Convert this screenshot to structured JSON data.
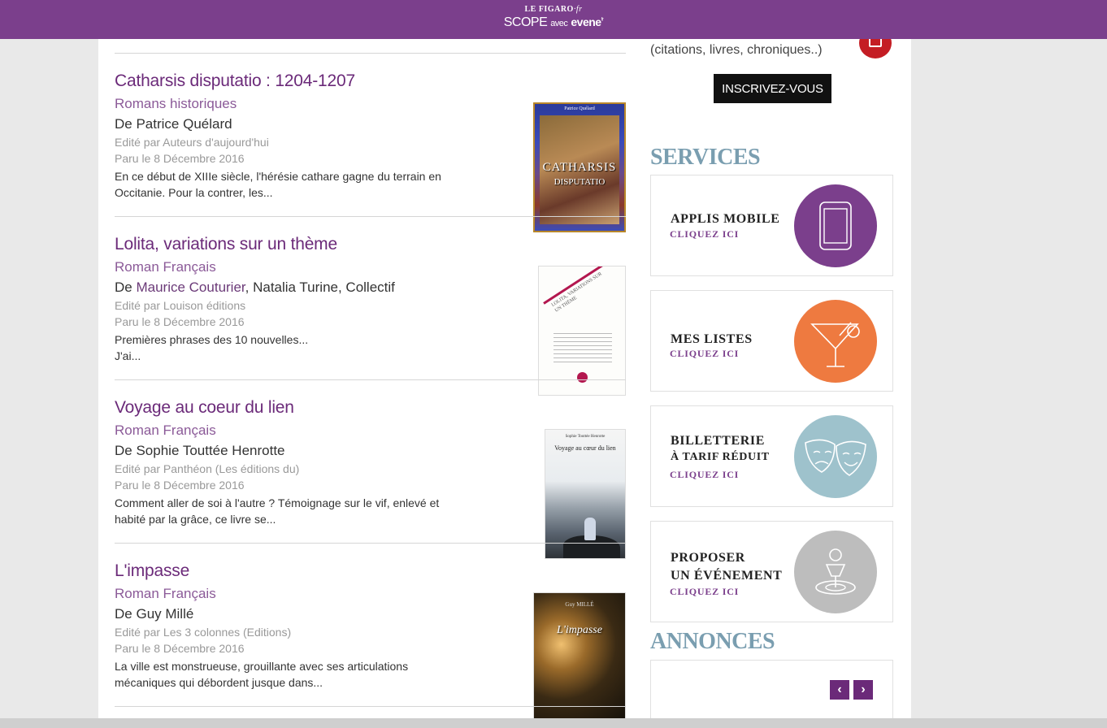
{
  "header": {
    "brand_top": "LE FIGARO",
    "brand_top_suffix": "·fr",
    "brand_scope": "SCOPE",
    "brand_avec": "avec",
    "brand_evene": "evene",
    "brand_evene_suffix": "fr"
  },
  "books": [
    {
      "title": "Catharsis disputatio : 1204-1207",
      "genre": "Romans historiques",
      "author_prefix": "De",
      "author": "Patrice Quélard",
      "editor": "Edité par Auteurs d'aujourd'hui",
      "date": "Paru le 8 Décembre 2016",
      "description": "En ce début de XIIIe siècle, l'hérésie cathare gagne du terrain en Occitanie. Pour la contrer, les...",
      "cover_header": "Patrice Quélard",
      "cover_title": "CATHARSIS",
      "cover_subtitle": "DISPUTATIO"
    },
    {
      "title": "Lolita, variations sur un thème",
      "genre": "Roman Français",
      "author_prefix": "De",
      "author_link": "Maurice Couturier",
      "author_rest": ", Natalia Turine, Collectif",
      "editor": "Edité par Louison éditions",
      "date": "Paru le 8 Décembre 2016",
      "description": "Premières phrases des 10 nouvelles...",
      "description_2": "J'ai...",
      "cover_title": "LOLITA, VARIATIONS SUR UN THÈME"
    },
    {
      "title": "Voyage au coeur du lien",
      "genre": "Roman Français",
      "author_prefix": "De",
      "author": "Sophie Touttée Henrotte",
      "editor": "Edité par Panthéon (Les éditions du)",
      "date": "Paru le 8 Décembre 2016",
      "description": "Comment aller de soi à l'autre ? Témoignage sur le vif, enlevé et habité par la grâce, ce livre se...",
      "cover_author": "Sophie Touttée Henrotte",
      "cover_title": "Voyage au cœur du lien"
    },
    {
      "title": "L'impasse",
      "genre": "Roman Français",
      "author_prefix": "De",
      "author": "Guy Millé",
      "editor": "Edité par Les 3 colonnes (Editions)",
      "date": "Paru le 8 Décembre 2016",
      "description": "La ville est monstrueuse, grouillante avec ses articulations mécaniques qui débordent jusque dans...",
      "cover_author": "Guy MILLÉ",
      "cover_title": "L'impasse"
    }
  ],
  "sidebar": {
    "subscribe_text": "(citations, livres, chroniques..)",
    "subscribe_button": "INSCRIVEZ-VOUS",
    "services_title": "SERVICES",
    "services": [
      {
        "name": "APPLIS MOBILE",
        "cta": "CLIQUEZ ICI",
        "color": "#7b3f8c",
        "icon": "mobile-icon"
      },
      {
        "name": "MES LISTES",
        "cta": "CLIQUEZ ICI",
        "color": "#ee7a40",
        "icon": "cocktail-icon"
      },
      {
        "name": "BILLETTERIE",
        "name_2": "À TARIF RÉDUIT",
        "cta": "CLIQUEZ ICI",
        "color": "#9ec2cc",
        "icon": "theatre-masks-icon"
      },
      {
        "name": "PROPOSER",
        "name_2": "UN ÉVÉNEMENT",
        "cta": "CLIQUEZ ICI",
        "color": "#bdbdbd",
        "icon": "event-pin-icon"
      }
    ],
    "annonces_title": "ANNONCES",
    "prev": "‹",
    "next": "›"
  },
  "colors": {
    "brand": "#7b3f8c",
    "services_heading": "#7a9eb0",
    "badge": "#c41d24"
  }
}
